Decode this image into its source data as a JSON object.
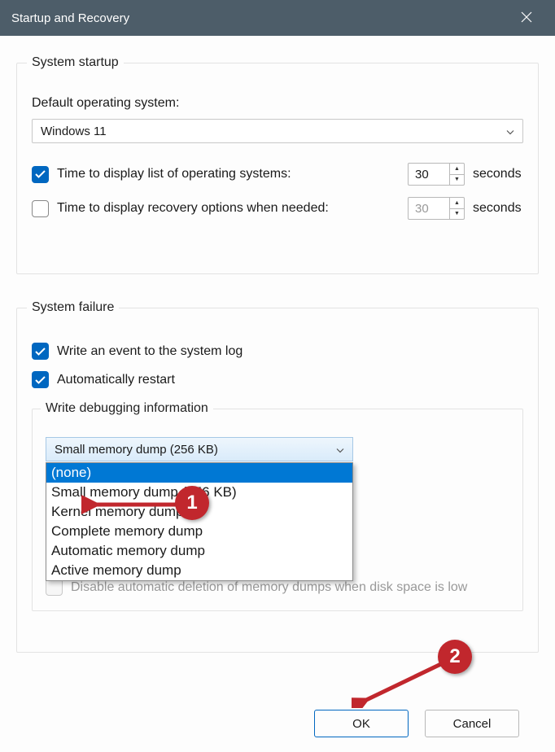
{
  "title": "Startup and Recovery",
  "system_startup": {
    "legend": "System startup",
    "default_os_label": "Default operating system:",
    "default_os_value": "Windows 11",
    "display_list_label": "Time to display list of operating systems:",
    "display_list_value": "30",
    "display_list_checked": true,
    "display_recovery_label": "Time to display recovery options when needed:",
    "display_recovery_value": "30",
    "display_recovery_checked": false,
    "seconds_label": "seconds"
  },
  "system_failure": {
    "legend": "System failure",
    "write_event_label": "Write an event to the system log",
    "write_event_checked": true,
    "auto_restart_label": "Automatically restart",
    "auto_restart_checked": true,
    "debug_legend": "Write debugging information",
    "debug_selected": "Small memory dump (256 KB)",
    "debug_options": [
      "(none)",
      "Small memory dump (256 KB)",
      "Kernel memory dump",
      "Complete memory dump",
      "Automatic memory dump",
      "Active memory dump"
    ],
    "debug_highlighted_index": 0,
    "disable_deletion_label": "Disable automatic deletion of memory dumps when disk space is low",
    "disable_deletion_enabled": false
  },
  "buttons": {
    "ok": "OK",
    "cancel": "Cancel"
  },
  "annotations": {
    "step1": "1",
    "step2": "2"
  }
}
